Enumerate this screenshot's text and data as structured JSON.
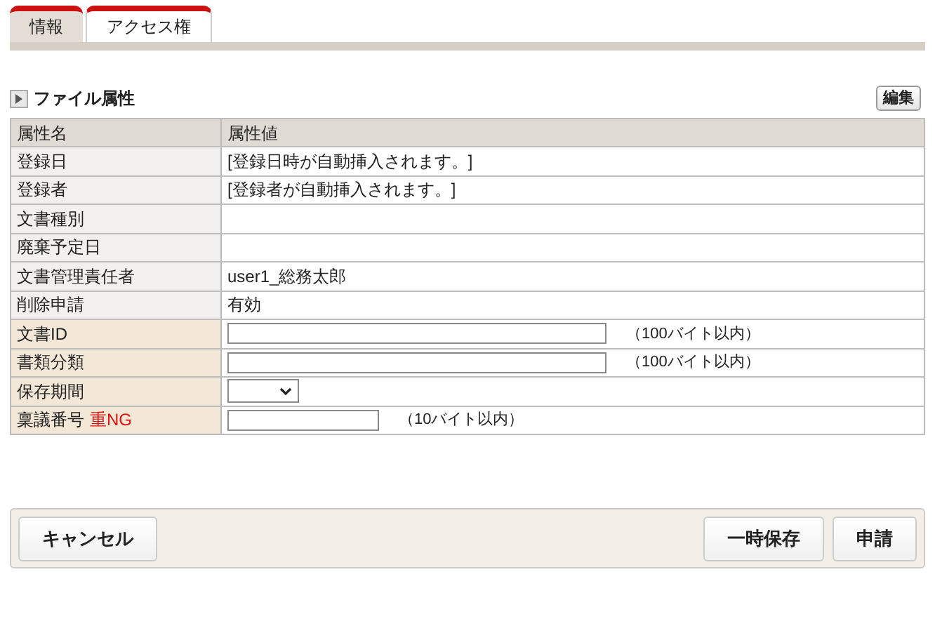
{
  "tabs": [
    {
      "label": "情報",
      "selected": true
    },
    {
      "label": "アクセス権",
      "selected": false
    }
  ],
  "section": {
    "title": "ファイル属性",
    "edit_button": "編集"
  },
  "table": {
    "columns": [
      "属性名",
      "属性値"
    ],
    "rows": [
      {
        "kind": "text",
        "label": "登録日",
        "value": "[登録日時が自動挿入されます。]"
      },
      {
        "kind": "text",
        "label": "登録者",
        "value": "[登録者が自動挿入されます。]"
      },
      {
        "kind": "text",
        "label": "文書種別"
      },
      {
        "kind": "text",
        "label": "廃棄予定日"
      },
      {
        "kind": "text",
        "label": "文書管理責任者",
        "value": "user1_総務太郎"
      },
      {
        "kind": "text",
        "label": "削除申請",
        "value": "有効"
      },
      {
        "kind": "field",
        "label": "文書ID",
        "hint": "（100バイト以内）"
      },
      {
        "kind": "field",
        "label": "書類分類",
        "hint": "（100バイト以内）"
      },
      {
        "kind": "select",
        "label": "保存期間"
      },
      {
        "kind": "shortfield",
        "label": "稟議番号",
        "flag": "重NG",
        "note": "（10バイト以内）"
      }
    ]
  },
  "footer": {
    "left_buttons": [
      "キャンセル"
    ],
    "right_buttons": [
      "一時保存",
      "申請"
    ]
  }
}
